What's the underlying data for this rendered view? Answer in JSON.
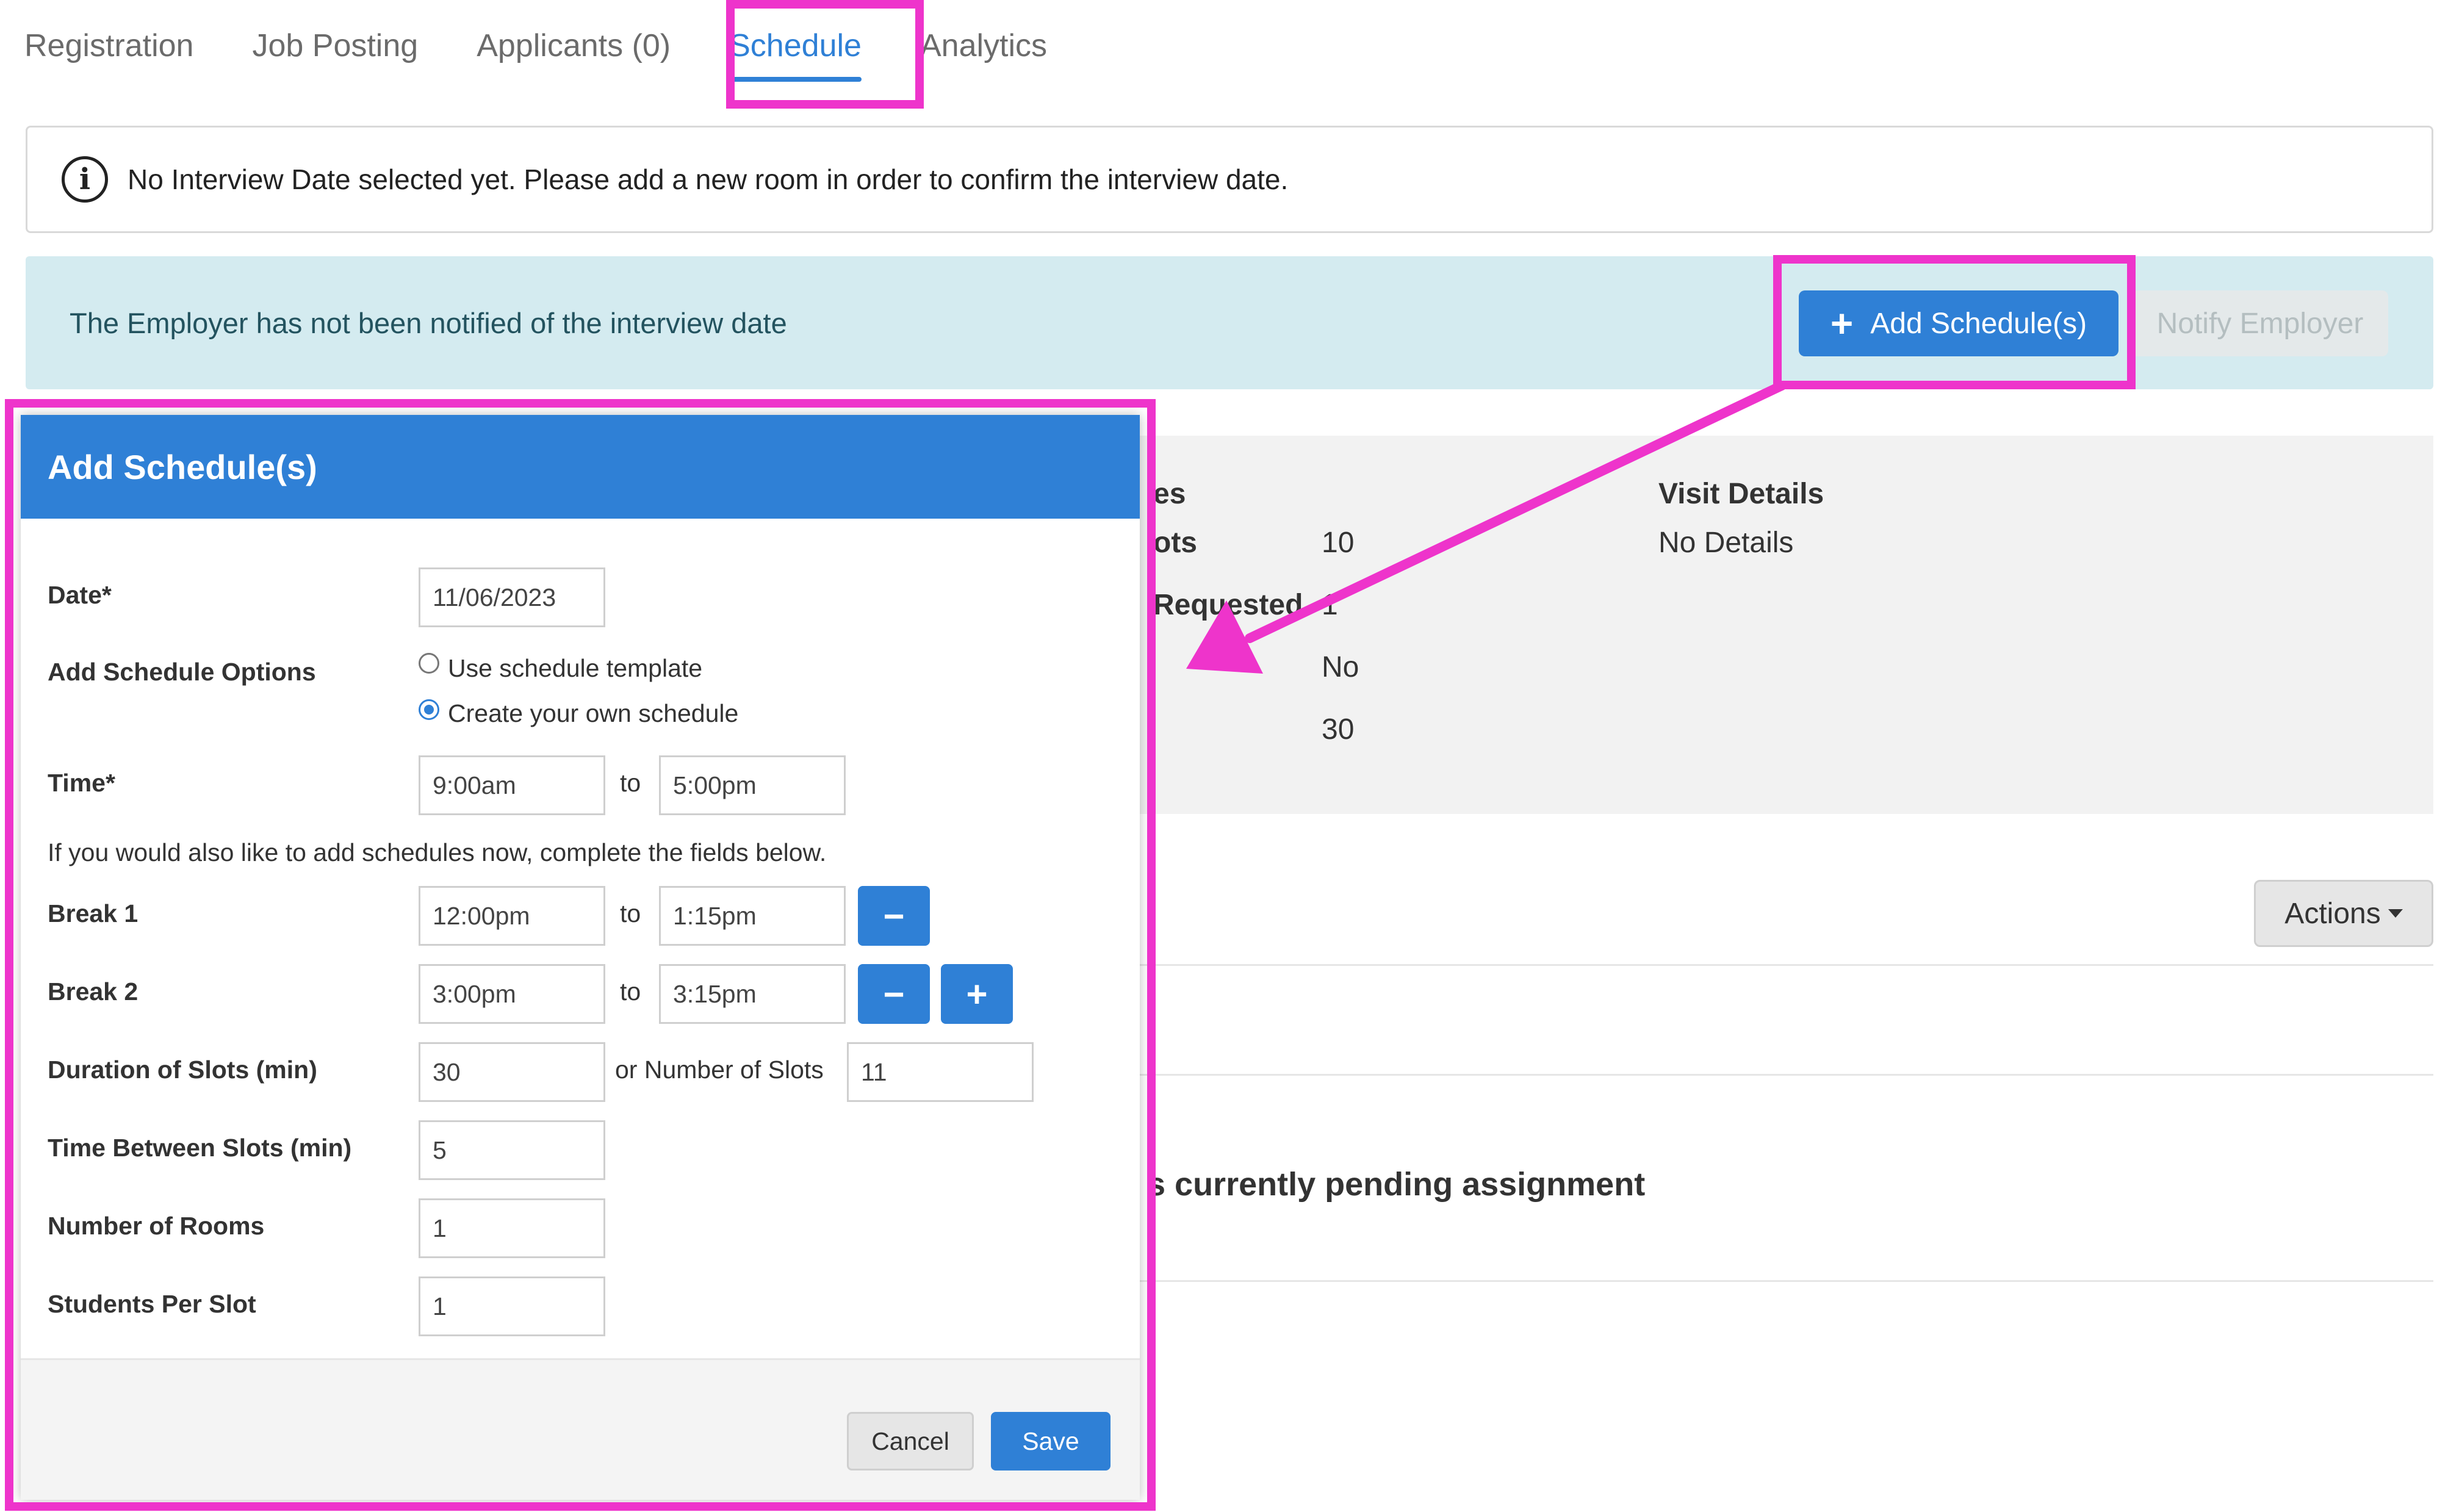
{
  "tabs": [
    {
      "label": "Registration"
    },
    {
      "label": "Job Posting"
    },
    {
      "label": "Applicants (0)"
    },
    {
      "label": "Schedule",
      "active": true
    },
    {
      "label": "Analytics"
    }
  ],
  "info": {
    "icon": "info-icon",
    "text": "No Interview Date selected yet. Please add a new room in order to confirm the interview date."
  },
  "notification": {
    "text": "The Employer has not been notified of the interview date",
    "add_button": "Add Schedule(s)",
    "notify_button": "Notify Employer"
  },
  "background": {
    "heading_fragment": "es",
    "slots_label_fragment": "ots",
    "slots_value": "10",
    "requested_fragment": "Requested",
    "requested_value": "1",
    "row3_value": "No",
    "row4_value": "30",
    "visit_title": "Visit Details",
    "visit_value": "No Details",
    "actions_label": "Actions",
    "pending_fragment": "s currently pending assignment"
  },
  "modal": {
    "title": "Add Schedule(s)",
    "date_label": "Date*",
    "date_value": "11/06/2023",
    "options_label": "Add Schedule Options",
    "option_template": "Use schedule template",
    "option_own": "Create your own schedule",
    "time_label": "Time*",
    "time_start": "9:00am",
    "to": "to",
    "time_end": "5:00pm",
    "schedules_note": "If you would also like to add schedules now, complete the fields below.",
    "break1_label": "Break 1",
    "break1_start": "12:00pm",
    "break1_end": "1:15pm",
    "break2_label": "Break 2",
    "break2_start": "3:00pm",
    "break2_end": "3:15pm",
    "duration_label": "Duration of Slots (min)",
    "duration_value": "30",
    "number_slots_label": "or Number of Slots",
    "number_slots_value": "11",
    "between_label": "Time Between Slots (min)",
    "between_value": "5",
    "rooms_label": "Number of Rooms",
    "rooms_value": "1",
    "students_label": "Students Per Slot",
    "students_value": "1",
    "cancel": "Cancel",
    "save": "Save"
  },
  "colors": {
    "accent": "#2f80d6",
    "highlight": "#ee34cb",
    "notice_bg": "#d4ebf0"
  }
}
